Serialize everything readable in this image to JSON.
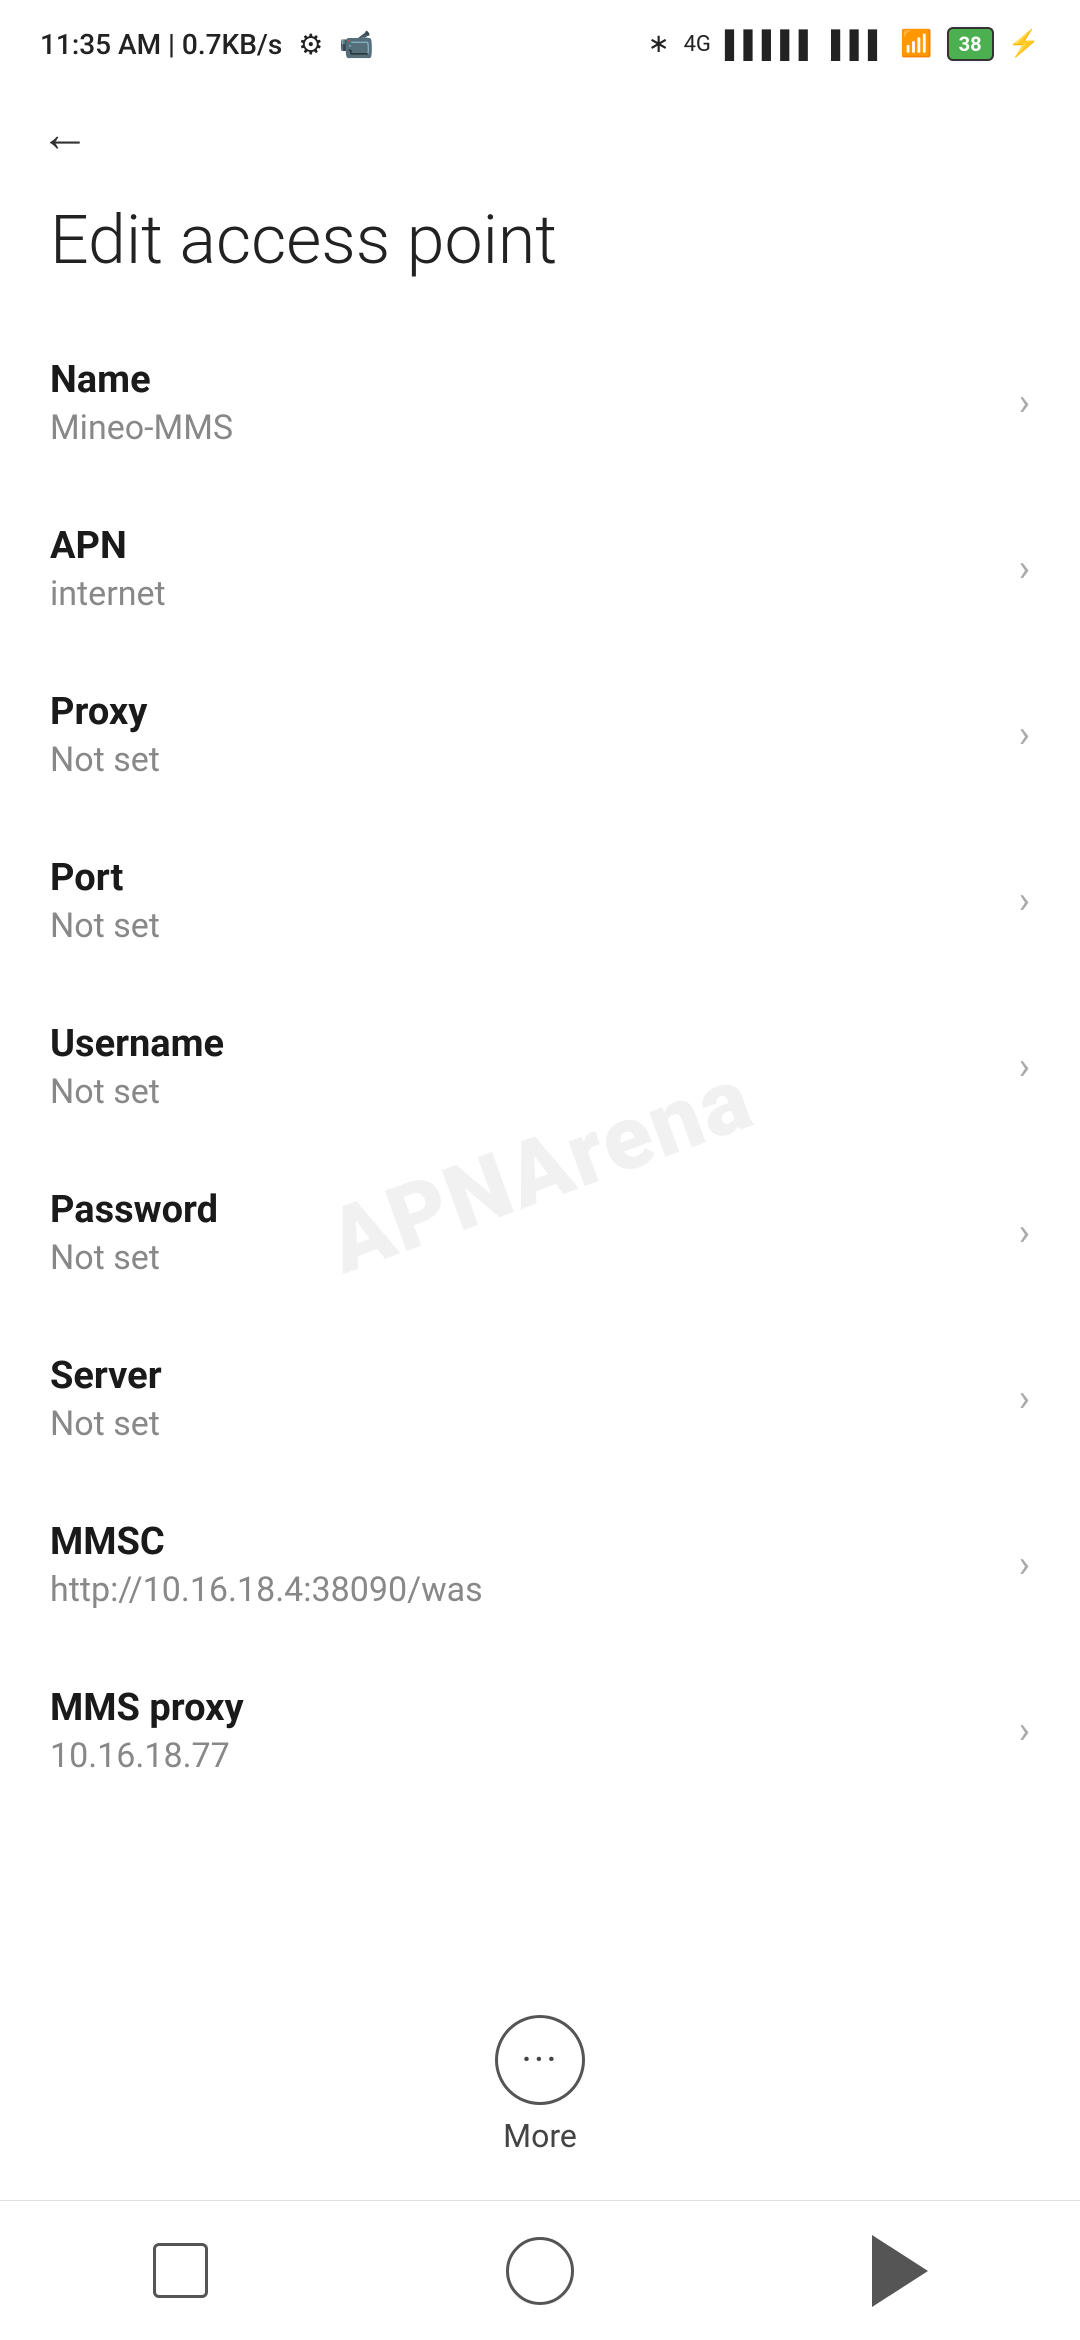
{
  "statusBar": {
    "time": "11:35 AM | 0.7KB/s",
    "battery": "38"
  },
  "page": {
    "title": "Edit access point",
    "backLabel": "←"
  },
  "items": [
    {
      "label": "Name",
      "value": "Mineo-MMS"
    },
    {
      "label": "APN",
      "value": "internet"
    },
    {
      "label": "Proxy",
      "value": "Not set"
    },
    {
      "label": "Port",
      "value": "Not set"
    },
    {
      "label": "Username",
      "value": "Not set"
    },
    {
      "label": "Password",
      "value": "Not set"
    },
    {
      "label": "Server",
      "value": "Not set"
    },
    {
      "label": "MMSC",
      "value": "http://10.16.18.4:38090/was"
    },
    {
      "label": "MMS proxy",
      "value": "10.16.18.77"
    }
  ],
  "more": {
    "label": "More"
  },
  "watermark": "APNArena"
}
